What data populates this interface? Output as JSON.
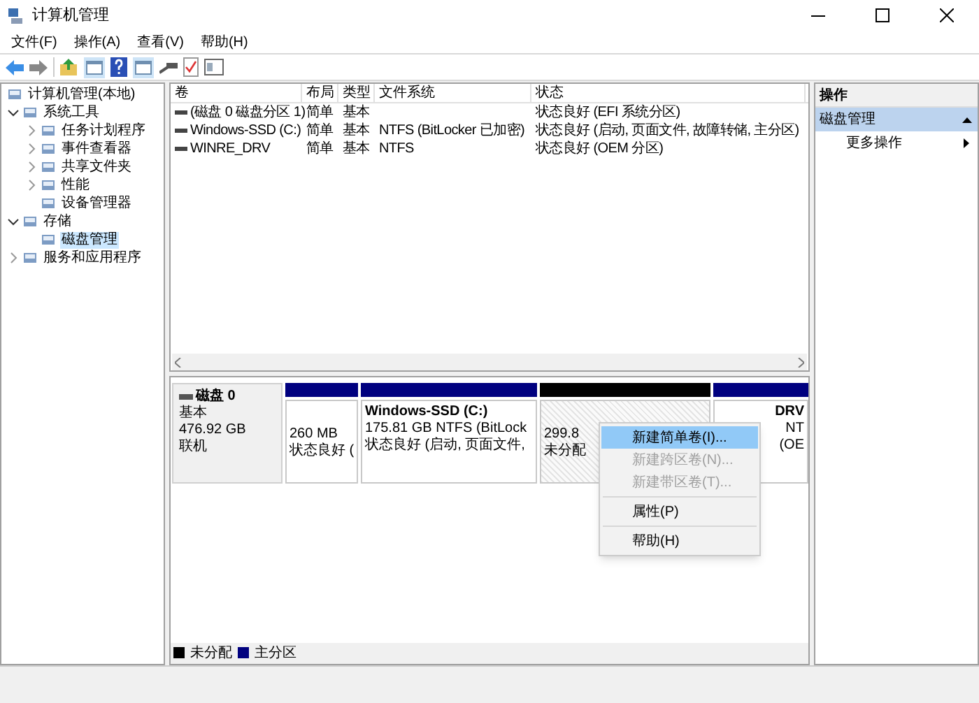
{
  "window": {
    "title": "计算机管理"
  },
  "menu_bar": [
    "文件(F)",
    "操作(A)",
    "查看(V)",
    "帮助(H)"
  ],
  "tree": [
    {
      "label": "计算机管理(本地)",
      "selected": false,
      "children": [
        {
          "label": "系统工具",
          "selected": false,
          "expanded": true,
          "children": [
            {
              "label": "任务计划程序",
              "selected": false,
              "expanded": false
            },
            {
              "label": "事件查看器",
              "selected": false,
              "expanded": false
            },
            {
              "label": "共享文件夹",
              "selected": false,
              "expanded": false
            },
            {
              "label": "性能",
              "selected": false,
              "expanded": false
            },
            {
              "label": "设备管理器",
              "selected": false
            }
          ]
        },
        {
          "label": "存储",
          "selected": false,
          "expanded": true,
          "children": [
            {
              "label": "磁盘管理",
              "selected": true
            }
          ]
        },
        {
          "label": "服务和应用程序",
          "selected": false,
          "expanded": false
        }
      ]
    }
  ],
  "volumes": {
    "columns": [
      "卷",
      "布局",
      "类型",
      "文件系统",
      "状态"
    ],
    "rows": [
      [
        "(磁盘 0 磁盘分区 1)",
        "简单",
        "基本",
        "",
        "状态良好 (EFI 系统分区)"
      ],
      [
        "Windows-SSD (C:)",
        "简单",
        "基本",
        "NTFS (BitLocker 已加密)",
        "状态良好 (启动, 页面文件, 故障转储, 主分区)"
      ],
      [
        "WINRE_DRV",
        "简单",
        "基本",
        "NTFS",
        "状态良好 (OEM 分区)"
      ]
    ]
  },
  "disk": {
    "name": "磁盘 0",
    "type": "基本",
    "size": "476.92 GB",
    "state": "联机",
    "partitions": [
      {
        "color": "#00007f",
        "selected": false,
        "lines": [
          "260 MB",
          "状态良好 ("
        ]
      },
      {
        "color": "#00007f",
        "selected": false,
        "name": "Windows-SSD  (C:)",
        "lines": [
          "175.81 GB NTFS (BitLock",
          "状态良好 (启动, 页面文件,"
        ]
      },
      {
        "color": "#000000",
        "selected": true,
        "lines": [
          "299.8",
          "未分配"
        ]
      },
      {
        "color": "#00007f",
        "selected": false,
        "name": "DRV",
        "lines": [
          "NT",
          "(OE"
        ]
      }
    ]
  },
  "legend": [
    {
      "color": "#000000",
      "label": "未分配"
    },
    {
      "color": "#00007f",
      "label": "主分区"
    }
  ],
  "context_menu": [
    {
      "label": "新建简单卷(I)...",
      "selected": true,
      "disabled": false
    },
    {
      "label": "新建跨区卷(N)...",
      "selected": false,
      "disabled": true
    },
    {
      "label": "新建带区卷(T)...",
      "selected": false,
      "disabled": true,
      "separator_after": true
    },
    {
      "label": "属性(P)",
      "selected": false,
      "disabled": false,
      "separator_after": true
    },
    {
      "label": "帮助(H)",
      "selected": false,
      "disabled": false
    }
  ],
  "actions": {
    "title": "操作",
    "section": {
      "label": "磁盘管理",
      "expanded": true
    },
    "items": [
      "更多操作"
    ]
  }
}
